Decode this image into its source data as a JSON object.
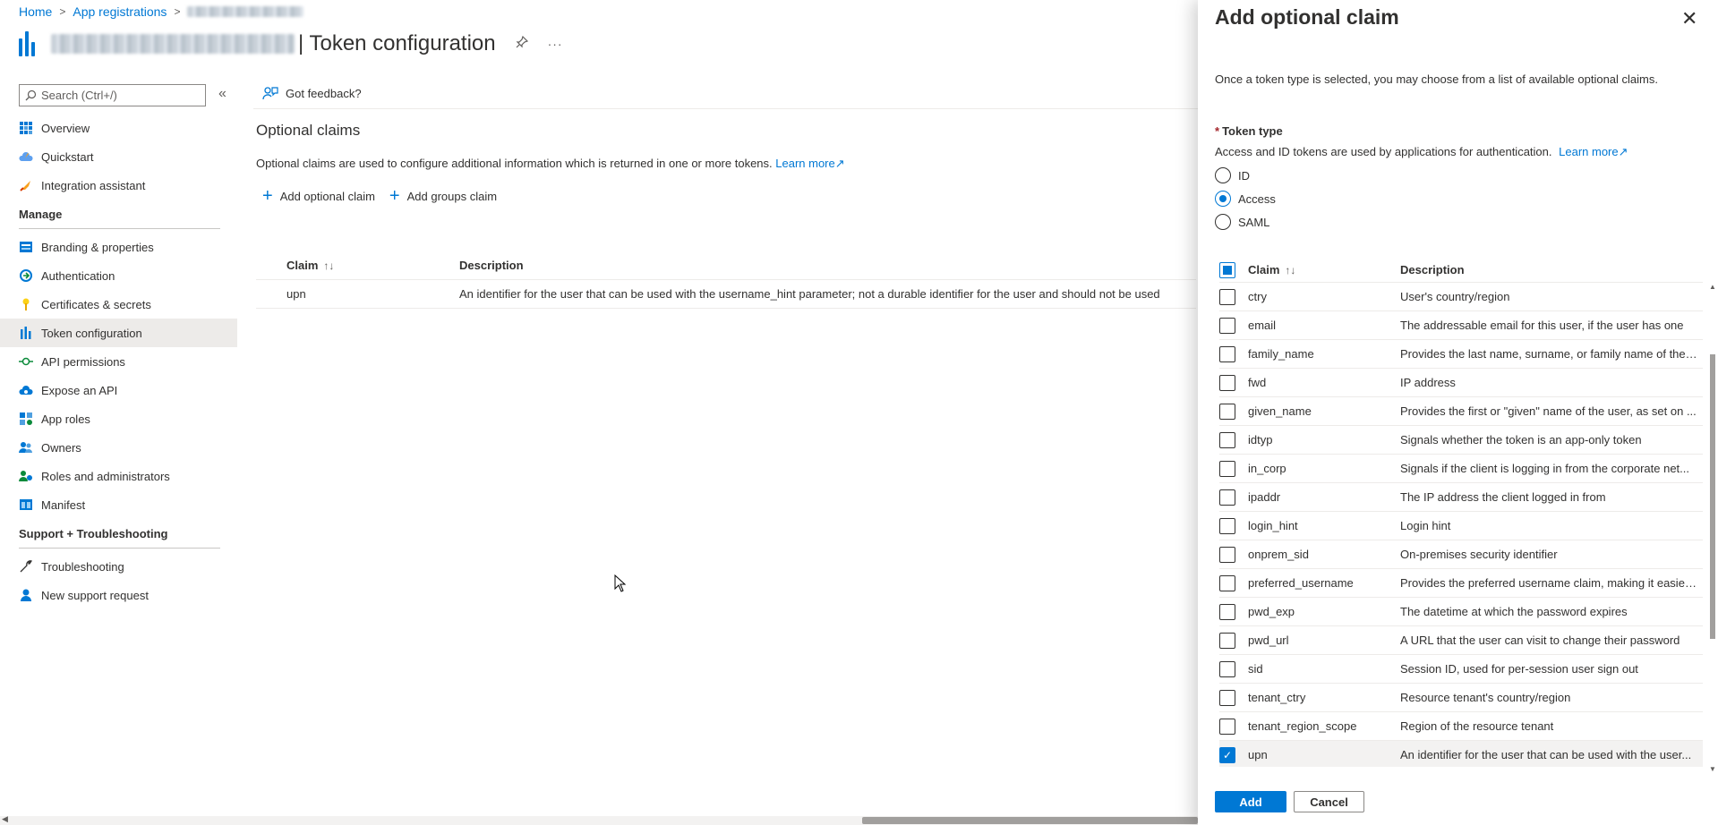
{
  "breadcrumb": {
    "home": "Home",
    "app_registrations": "App registrations"
  },
  "header": {
    "title": "| Token configuration",
    "pin_icon": "pin-icon",
    "more_icon": "more-icon"
  },
  "search": {
    "placeholder": "Search (Ctrl+/)"
  },
  "nav": {
    "top": [
      {
        "label": "Overview",
        "icon": "grid-icon"
      },
      {
        "label": "Quickstart",
        "icon": "cloud-rocket-icon"
      },
      {
        "label": "Integration assistant",
        "icon": "rocket-icon"
      }
    ],
    "manage_label": "Manage",
    "manage": [
      {
        "label": "Branding & properties",
        "icon": "branding-icon"
      },
      {
        "label": "Authentication",
        "icon": "authentication-icon"
      },
      {
        "label": "Certificates & secrets",
        "icon": "key-icon"
      },
      {
        "label": "Token configuration",
        "icon": "token-bars-icon",
        "active": true
      },
      {
        "label": "API permissions",
        "icon": "api-permissions-icon"
      },
      {
        "label": "Expose an API",
        "icon": "cloud-icon"
      },
      {
        "label": "App roles",
        "icon": "app-roles-icon"
      },
      {
        "label": "Owners",
        "icon": "owners-icon"
      },
      {
        "label": "Roles and administrators",
        "icon": "roles-admin-icon"
      },
      {
        "label": "Manifest",
        "icon": "manifest-icon"
      }
    ],
    "support_label": "Support + Troubleshooting",
    "support": [
      {
        "label": "Troubleshooting",
        "icon": "wrench-icon"
      },
      {
        "label": "New support request",
        "icon": "support-person-icon"
      }
    ]
  },
  "main": {
    "feedback": "Got feedback?",
    "section_title": "Optional claims",
    "section_desc": "Optional claims are used to configure additional information which is returned in one or more tokens.",
    "learn_more": "Learn more",
    "add_optional_claim": "Add optional claim",
    "add_groups_claim": "Add groups claim",
    "table": {
      "col_claim": "Claim",
      "col_description": "Description",
      "rows": [
        {
          "claim": "upn",
          "description": "An identifier for the user that can be used with the username_hint parameter; not a durable identifier for the user and should not be used"
        }
      ]
    }
  },
  "panel": {
    "title": "Add optional claim",
    "intro": "Once a token type is selected, you may choose from a list of available optional claims.",
    "token_type_label": "Token type",
    "required_mark": "*",
    "token_type_desc": "Access and ID tokens are used by applications for authentication.",
    "learn_more": "Learn more",
    "options": [
      {
        "label": "ID",
        "selected": false
      },
      {
        "label": "Access",
        "selected": true
      },
      {
        "label": "SAML",
        "selected": false
      }
    ],
    "col_claim": "Claim",
    "col_description": "Description",
    "claims": [
      {
        "name": "ctry",
        "description": "User's country/region",
        "checked": false
      },
      {
        "name": "email",
        "description": "The addressable email for this user, if the user has one",
        "checked": false
      },
      {
        "name": "family_name",
        "description": "Provides the last name, surname, or family name of the ...",
        "checked": false
      },
      {
        "name": "fwd",
        "description": "IP address",
        "checked": false
      },
      {
        "name": "given_name",
        "description": "Provides the first or \"given\" name of the user, as set on ...",
        "checked": false
      },
      {
        "name": "idtyp",
        "description": "Signals whether the token is an app-only token",
        "checked": false
      },
      {
        "name": "in_corp",
        "description": "Signals if the client is logging in from the corporate net...",
        "checked": false
      },
      {
        "name": "ipaddr",
        "description": "The IP address the client logged in from",
        "checked": false
      },
      {
        "name": "login_hint",
        "description": "Login hint",
        "checked": false
      },
      {
        "name": "onprem_sid",
        "description": "On-premises security identifier",
        "checked": false
      },
      {
        "name": "preferred_username",
        "description": "Provides the preferred username claim, making it easier...",
        "checked": false
      },
      {
        "name": "pwd_exp",
        "description": "The datetime at which the password expires",
        "checked": false
      },
      {
        "name": "pwd_url",
        "description": "A URL that the user can visit to change their password",
        "checked": false
      },
      {
        "name": "sid",
        "description": "Session ID, used for per-session user sign out",
        "checked": false
      },
      {
        "name": "tenant_ctry",
        "description": "Resource tenant's country/region",
        "checked": false
      },
      {
        "name": "tenant_region_scope",
        "description": "Region of the resource tenant",
        "checked": false
      },
      {
        "name": "upn",
        "description": "An identifier for the user that can be used with the user...",
        "checked": true
      }
    ],
    "add_button": "Add",
    "cancel_button": "Cancel"
  },
  "colors": {
    "accent": "#0078d4",
    "text": "#323130",
    "nav_active": "#edebe9",
    "required": "#a4262c"
  }
}
